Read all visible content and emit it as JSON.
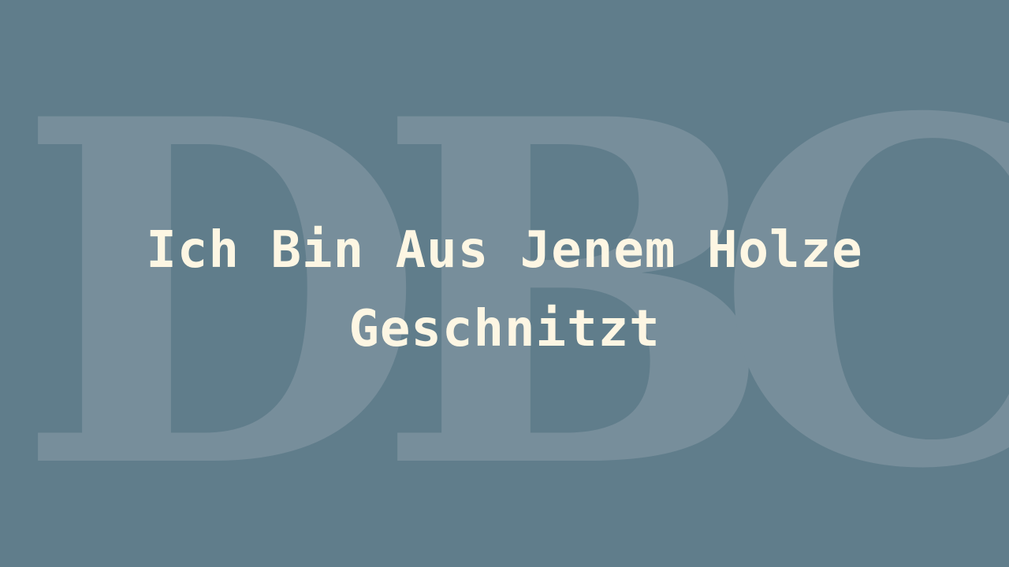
{
  "background_color": "#607d8b",
  "watermark": {
    "letters": [
      "D",
      "B",
      "C"
    ],
    "color": "#778e9b"
  },
  "title": {
    "line1": "Ich Bin Aus Jenem Holze",
    "line2": "Geschnitzt",
    "color": "#fdf6e3"
  }
}
